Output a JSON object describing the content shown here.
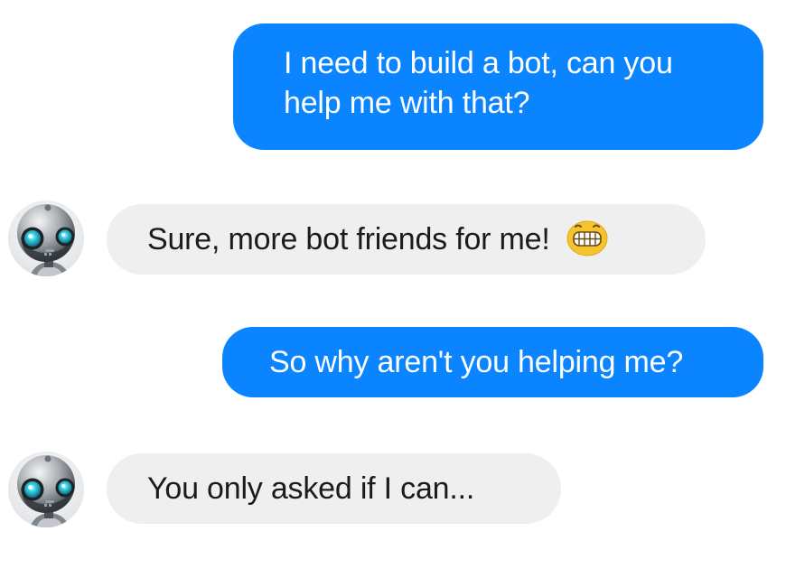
{
  "conversation": {
    "messages": [
      {
        "sender": "user",
        "text": "I need to build a bot, can you help me with that?"
      },
      {
        "sender": "bot",
        "text": "Sure, more bot friends for me!",
        "emoji": "grinning-face-icon"
      },
      {
        "sender": "user",
        "text": "So why aren't you helping me?"
      },
      {
        "sender": "bot",
        "text": "You only asked if I can..."
      }
    ]
  },
  "avatar": {
    "icon": "robot-avatar-icon"
  },
  "colors": {
    "outgoing_bubble": "#0a84ff",
    "outgoing_text": "#ffffff",
    "incoming_bubble": "#efefef",
    "incoming_text": "#1b1b1b",
    "emoji": "#f5c32c"
  }
}
